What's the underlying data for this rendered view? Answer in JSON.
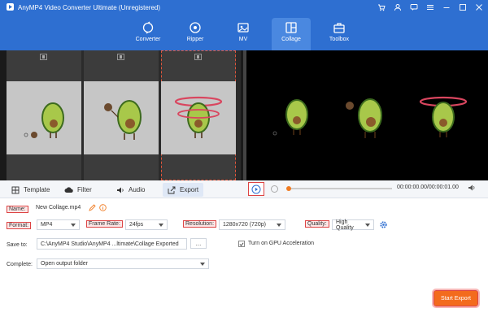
{
  "window": {
    "title": "AnyMP4 Video Converter Ultimate (Unregistered)",
    "icons": [
      "cart-icon",
      "user-icon",
      "chat-icon",
      "menu-icon",
      "minimize-icon",
      "maximize-icon",
      "close-icon"
    ]
  },
  "nav": {
    "tabs": [
      {
        "label": "Converter",
        "icon": "convert-icon"
      },
      {
        "label": "Ripper",
        "icon": "disc-icon"
      },
      {
        "label": "MV",
        "icon": "mv-icon"
      },
      {
        "label": "Collage",
        "icon": "collage-icon",
        "active": true
      },
      {
        "label": "Toolbox",
        "icon": "toolbox-icon"
      }
    ]
  },
  "edit_tabs": {
    "template": "Template",
    "filter": "Filter",
    "audio": "Audio",
    "export": "Export"
  },
  "player": {
    "time": "00:00:00.00/00:00:01.00",
    "progress": 0
  },
  "export": {
    "name_label": "Name:",
    "name_value": "New Collage.mp4",
    "format_label": "Format:",
    "format_value": "MP4",
    "frame_rate_label": "Frame Rate:",
    "frame_rate_value": "24fps",
    "resolution_label": "Resolution:",
    "resolution_value": "1280x720 (720p)",
    "quality_label": "Quality:",
    "quality_value": "High Quality",
    "save_to_label": "Save to:",
    "save_to_value": "C:\\AnyMP4 Studio\\AnyMP4 ...ltimate\\Collage Exported",
    "browse_label": "...",
    "gpu_label": "Turn on GPU Acceleration",
    "gpu_checked": true,
    "complete_label": "Complete:",
    "complete_value": "Open output folder",
    "start_export_label": "Start Export"
  },
  "colors": {
    "accent": "#2e6fd1",
    "export_button": "#f36b1d",
    "highlight": "#dd4444"
  }
}
